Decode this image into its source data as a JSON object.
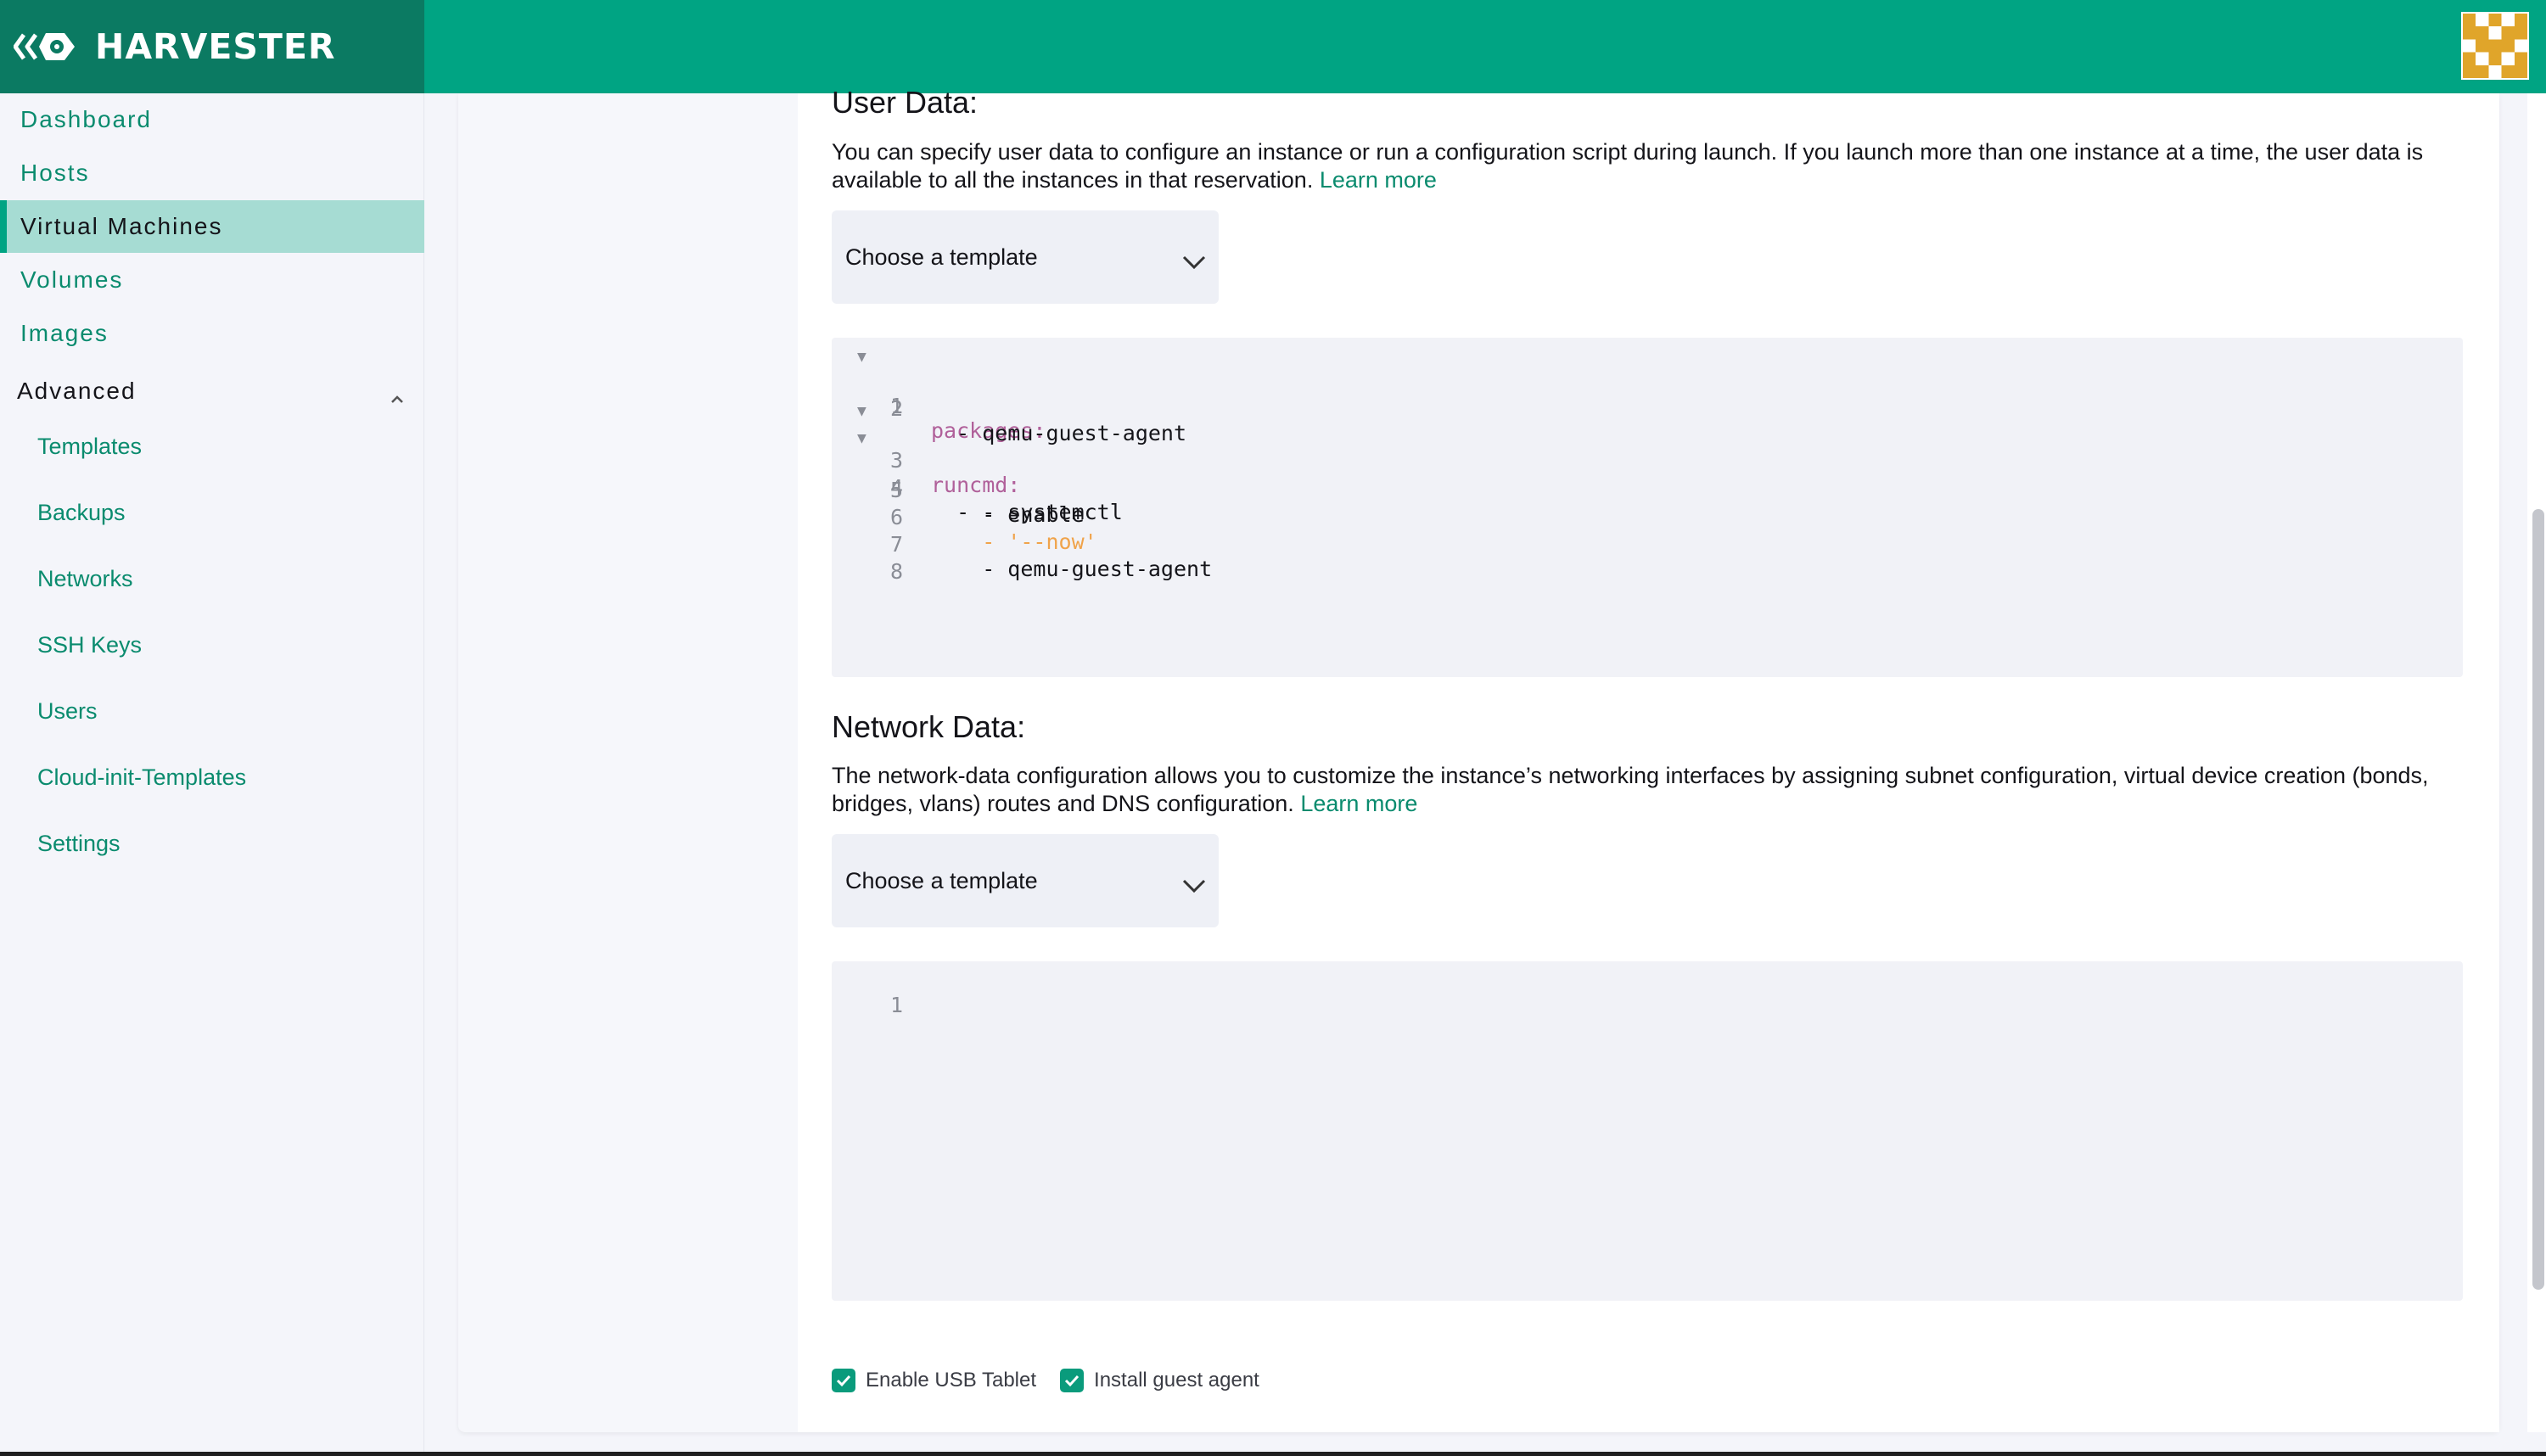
{
  "app": {
    "name": "HARVESTER"
  },
  "sidebar": {
    "items": [
      {
        "label": "Dashboard"
      },
      {
        "label": "Hosts"
      },
      {
        "label": "Virtual Machines",
        "active": true
      },
      {
        "label": "Volumes"
      },
      {
        "label": "Images"
      }
    ],
    "group": {
      "label": "Advanced",
      "expanded": true,
      "items": [
        {
          "label": "Templates"
        },
        {
          "label": "Backups"
        },
        {
          "label": "Networks"
        },
        {
          "label": "SSH Keys"
        },
        {
          "label": "Users"
        },
        {
          "label": "Cloud-init-Templates"
        },
        {
          "label": "Settings"
        }
      ]
    }
  },
  "user_data": {
    "title": "User Data:",
    "description": "You can specify user data to configure an instance or run a configuration script during launch. If you launch more than one instance at a time, the user data is available to all the instances in that reservation.",
    "learn_more": "Learn more",
    "select_label": "Choose a template",
    "code_lines": [
      {
        "num": "1",
        "fold": true,
        "text": "packages:"
      },
      {
        "num": "2",
        "fold": false,
        "text": "  - qemu-guest-agent"
      },
      {
        "num": "3",
        "fold": true,
        "text": "runcmd:"
      },
      {
        "num": "4",
        "fold": true,
        "text": "  - - systemctl"
      },
      {
        "num": "5",
        "fold": false,
        "text": "    - enable"
      },
      {
        "num": "6",
        "fold": false,
        "text": "    - '--now'"
      },
      {
        "num": "7",
        "fold": false,
        "text": "    - qemu-guest-agent"
      },
      {
        "num": "8",
        "fold": false,
        "text": ""
      }
    ]
  },
  "network_data": {
    "title": "Network Data:",
    "description": "The network-data configuration allows you to customize the instance’s networking interfaces by assigning subnet configuration, virtual device creation (bonds, bridges, vlans) routes and DNS configuration.",
    "learn_more": "Learn more",
    "select_label": "Choose a template",
    "code_lines": [
      {
        "num": "1",
        "text": ""
      }
    ]
  },
  "options": {
    "enable_usb_tablet": {
      "label": "Enable USB Tablet",
      "checked": true
    },
    "install_guest_agent": {
      "label": "Install guest agent",
      "checked": true
    }
  },
  "colors": {
    "header": "#00a483",
    "brand_bg": "#0b7a62",
    "accent": "#0a8b6e",
    "active_nav": "#a6dcd3",
    "yaml_key": "#b0609a",
    "yaml_string": "#f0a34a"
  }
}
